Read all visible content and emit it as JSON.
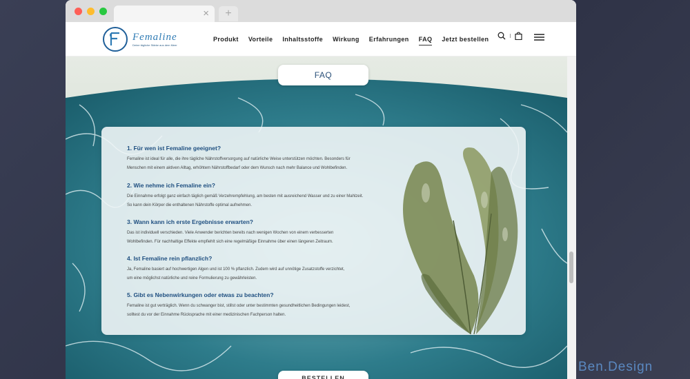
{
  "browser": {
    "tab_close": "×",
    "new_tab": "+"
  },
  "header": {
    "logo_name": "Femaline",
    "logo_tagline": "Deine tägliche Stärke aus dem Meer",
    "menu": [
      {
        "label": "Produkt"
      },
      {
        "label": "Vorteile"
      },
      {
        "label": "Inhaltsstoffe"
      },
      {
        "label": "Wirkung"
      },
      {
        "label": "Erfahrungen"
      },
      {
        "label": "FAQ",
        "active": true
      },
      {
        "label": "Jetzt bestellen"
      }
    ],
    "icons": [
      "search-icon",
      "shopping-bag-icon",
      "hamburger-menu-icon"
    ]
  },
  "section": {
    "title_button": "FAQ",
    "bottom_button": "BESTELLEN"
  },
  "faq": [
    {
      "question": "1. Für wen ist Femaline geeignet?",
      "answer_line1": "Femaline ist ideal für alle, die ihre tägliche Nährstoffversorgung auf natürliche Weise unterstützen möchten. Besonders für",
      "answer_line2": "Menschen mit einem aktiven Alltag, erhöhtem Nährstoffbedarf oder dem Wunsch nach mehr Balance und Wohlbefinden."
    },
    {
      "question": "2. Wie nehme ich Femaline ein?",
      "answer_line1": "Die Einnahme erfolgt ganz einfach täglich gemäß Verzehrempfehlung, am besten mit ausreichend Wasser und zu einer Mahlzeit.",
      "answer_line2": "So kann dein Körper die enthaltenen Nährstoffe optimal aufnehmen."
    },
    {
      "question": "3. Wann kann ich erste Ergebnisse erwarten?",
      "answer_line1": "Das ist individuell verschieden. Viele Anwender berichten bereits nach wenigen Wochen von einem verbesserten",
      "answer_line2": "Wohlbefinden. Für nachhaltige Effekte empfiehlt sich eine regelmäßige Einnahme über einen längeren Zeitraum."
    },
    {
      "question": "4. Ist Femaline rein pflanzlich?",
      "answer_line1": "Ja, Femaline basiert auf hochwertigen Algen und ist 100 % pflanzlich. Zudem wird auf unnötige Zusatzstoffe verzichtet,",
      "answer_line2": "um eine möglichst natürliche und reine Formulierung zu gewährleisten."
    },
    {
      "question": "5. Gibt es Nebenwirkungen oder etwas zu beachten?",
      "answer_line1": "Femaline ist gut verträglich. Wenn du schwanger bist, stillst oder unter bestimmten gesundheitlichen Bedingungen leidest,",
      "answer_line2": "solltest du vor der Einnahme Rücksprache mit einer medizinischen Fachperson halten."
    }
  ],
  "watermark": "Ben.Design",
  "colors": {
    "accent": "#2f7bb4",
    "heading": "#1f4f80",
    "water": "#2d7d8d"
  }
}
